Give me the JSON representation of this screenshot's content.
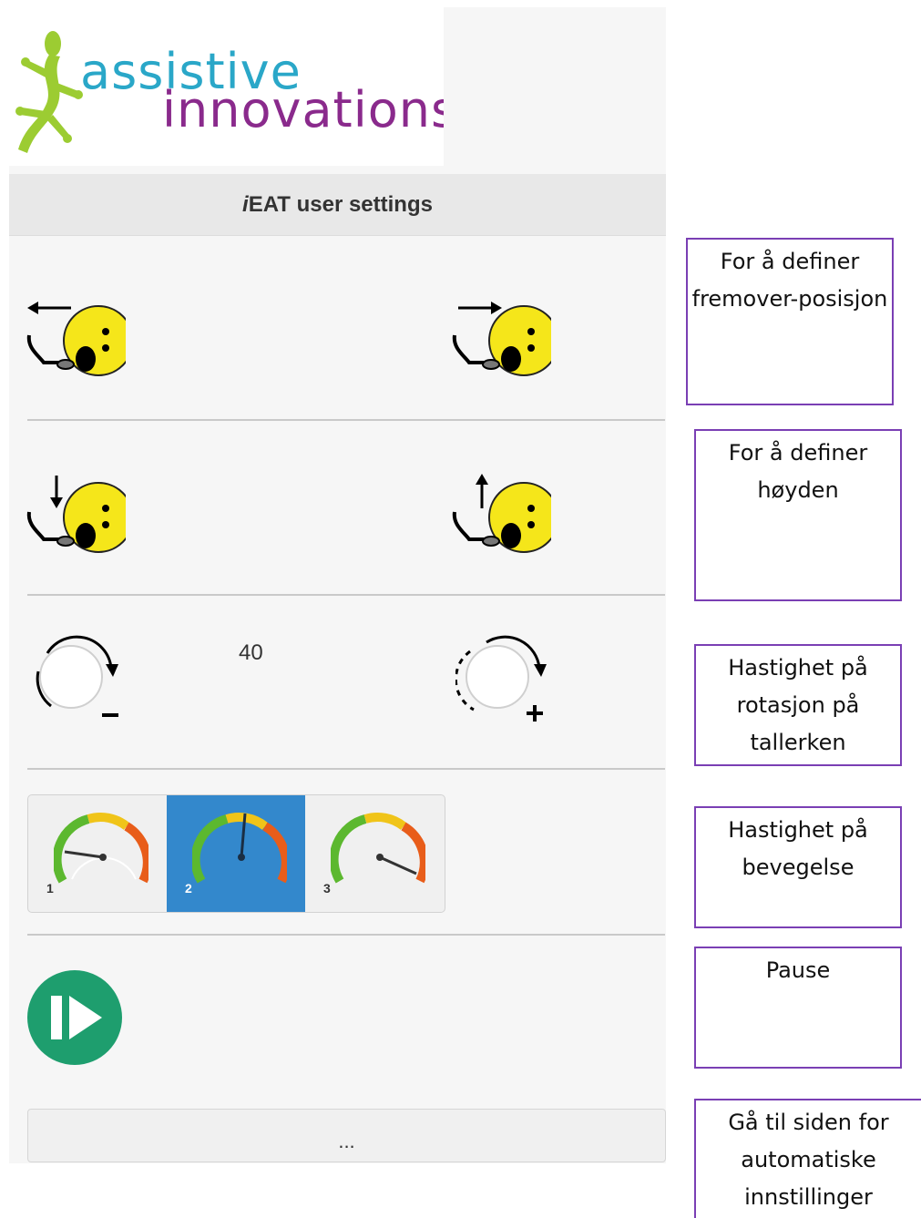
{
  "logo": {
    "line1": "assistive",
    "line2": "innovations"
  },
  "header": {
    "title": "iEAT user settings"
  },
  "rows": {
    "position": {
      "back_icon": "arrow-left-spoon-face-icon",
      "forward_icon": "arrow-right-spoon-face-icon"
    },
    "height": {
      "down_icon": "arrow-down-spoon-face-icon",
      "up_icon": "arrow-up-spoon-face-icon"
    },
    "rotation": {
      "minus_icon": "rotate-minus-icon",
      "plus_icon": "rotate-plus-icon",
      "value": "40"
    },
    "speed": {
      "options": [
        {
          "label": "1"
        },
        {
          "label": "2"
        },
        {
          "label": "3"
        }
      ],
      "selected": "2"
    },
    "pause": {
      "icon": "pause-play-icon"
    }
  },
  "footer": {
    "label": "..."
  },
  "notes": [
    "For å definer fremover-posisjon",
    "For å definer høyden",
    "Hastighet på rotasjon på tallerken",
    "Hastighet på bevegelse",
    "Pause",
    "Gå til siden for automatiske innstillinger"
  ],
  "colors": {
    "accent": "#3388cc",
    "note_border": "#7a3fb4",
    "pause_green": "#1e9e6e",
    "face_yellow": "#f5e61a"
  }
}
